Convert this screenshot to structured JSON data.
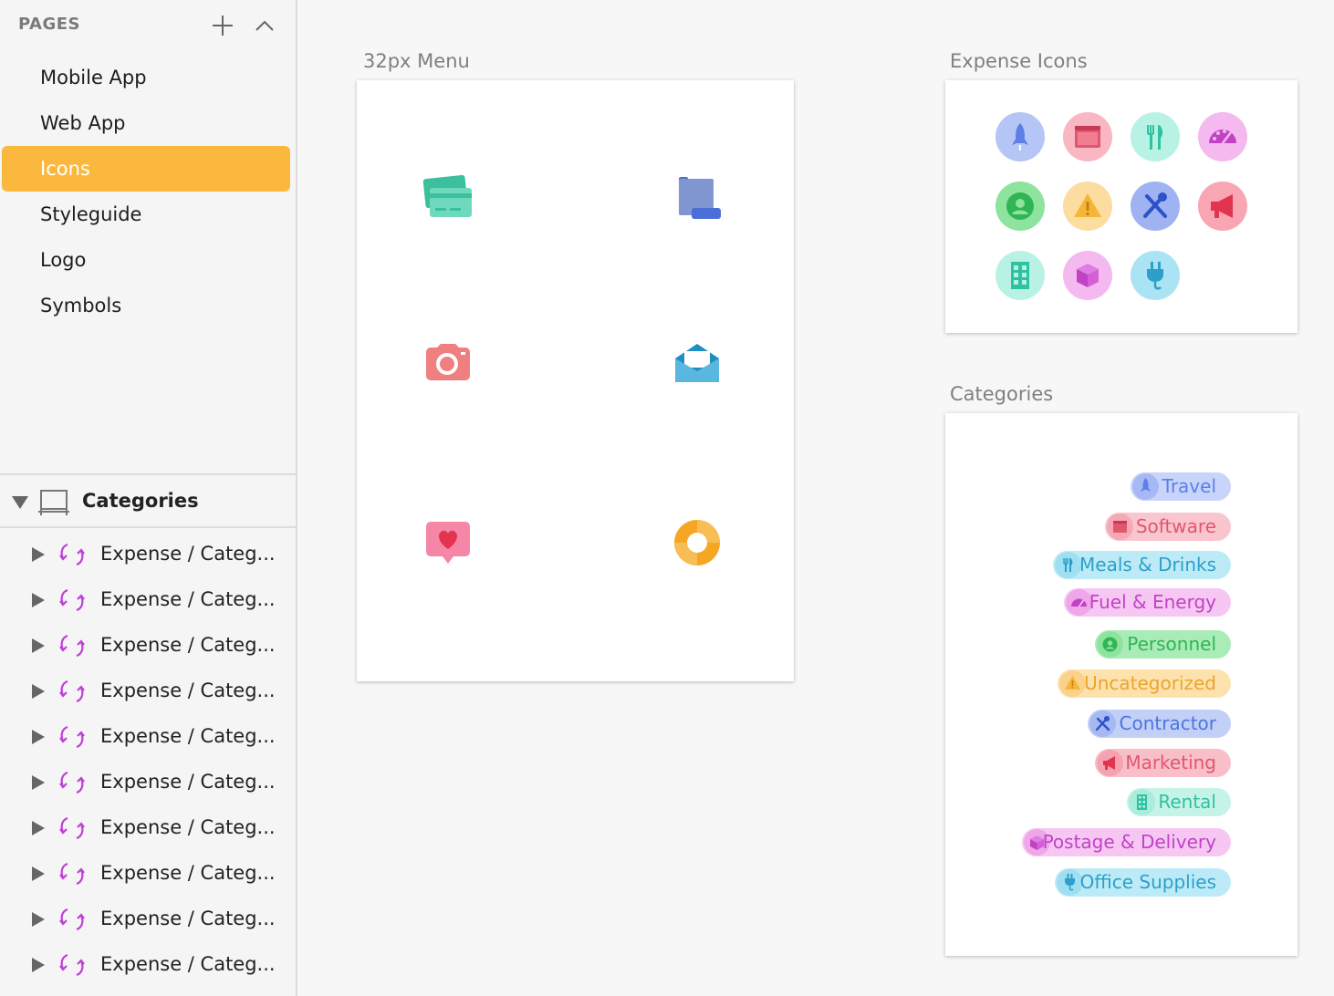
{
  "sidebar": {
    "pages_title": "PAGES",
    "pages": [
      "Mobile App",
      "Web App",
      "Icons",
      "Styleguide",
      "Logo",
      "Symbols"
    ],
    "active_page": "Icons",
    "layer_group": "Categories",
    "layers": [
      "Expense / Categ...",
      "Expense / Categ...",
      "Expense / Categ...",
      "Expense / Categ...",
      "Expense / Categ...",
      "Expense / Categ...",
      "Expense / Categ...",
      "Expense / Categ...",
      "Expense / Categ...",
      "Expense / Categ..."
    ]
  },
  "canvas": {
    "menu_artboard": {
      "title": "32px Menu",
      "icons": [
        "credit-cards-icon",
        "scroll-icon",
        "camera-icon",
        "open-envelope-icon",
        "heart-message-icon",
        "lifebuoy-icon"
      ]
    },
    "expense_artboard": {
      "title": "Expense Icons",
      "icons": [
        "rocket-icon",
        "browser-window-icon",
        "cutlery-icon",
        "speedometer-icon",
        "person-icon",
        "warning-icon",
        "wrench-screwdriver-icon",
        "megaphone-icon",
        "building-icon",
        "package-icon",
        "plug-icon"
      ]
    },
    "categories_artboard": {
      "title": "Categories",
      "tags": [
        "Travel",
        "Software",
        "Meals & Drinks",
        "Fuel & Energy",
        "Personnel",
        "Uncategorized",
        "Contractor",
        "Marketing",
        "Rental",
        "Postage & Delivery",
        "Office Supplies"
      ]
    }
  },
  "colors": {
    "accent": "#fbb83f",
    "symbol_purple": "#c03fd6",
    "travel": "#5d7fe6",
    "software": "#e2566f",
    "meals": "#2d9fc9",
    "fuel": "#c242c6",
    "personnel": "#2fb553",
    "uncategorized": "#eba52a",
    "contractor": "#4c73e0",
    "marketing": "#e2566f",
    "rental": "#2ec3a0",
    "postage": "#c242c6",
    "office": "#2d9fc9"
  }
}
